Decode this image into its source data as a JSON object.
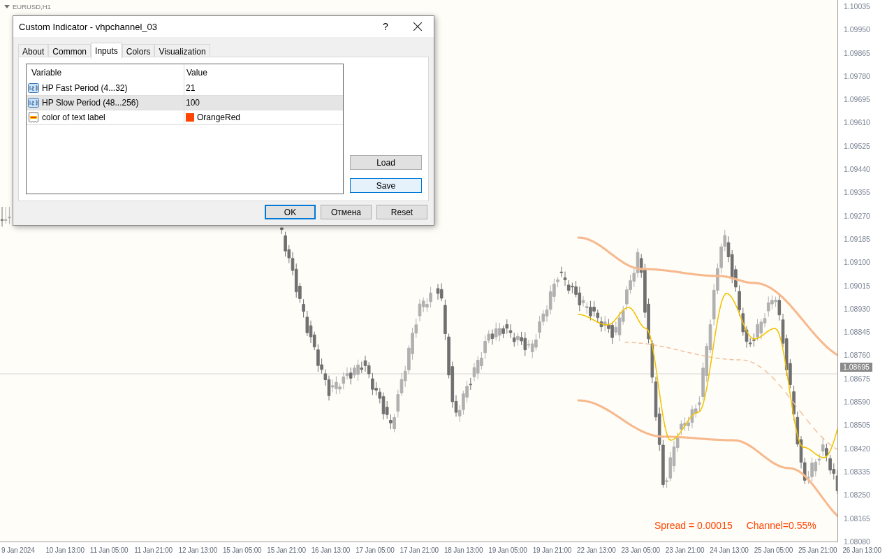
{
  "chart": {
    "symbol": "EURUSD,H1",
    "price_labels": [
      "1.10035",
      "1.09950",
      "1.09865",
      "1.09780",
      "1.09695",
      "1.09610",
      "1.09525",
      "1.09440",
      "1.09355",
      "1.09270",
      "1.09185",
      "1.09100",
      "1.09015",
      "1.08930",
      "1.08845",
      "1.08760",
      "1.08675",
      "1.08590",
      "1.08505",
      "1.08420",
      "1.08335",
      "1.08250",
      "1.08165",
      "1.08080"
    ],
    "current_price": "1.08695",
    "time_labels": [
      "9 Jan 2024",
      "10 Jan 13:00",
      "11 Jan 05:00",
      "11 Jan 21:00",
      "12 Jan 13:00",
      "15 Jan 05:00",
      "15 Jan 21:00",
      "16 Jan 13:00",
      "17 Jan 05:00",
      "17 Jan 21:00",
      "18 Jan 13:00",
      "19 Jan 05:00",
      "19 Jan 21:00",
      "22 Jan 13:00",
      "23 Jan 05:00",
      "23 Jan 21:00",
      "24 Jan 13:00",
      "25 Jan 05:00",
      "25 Jan 21:00",
      "26 Jan 13:00"
    ],
    "info": [
      "Spread = 0.00015",
      "Channel=0.55%"
    ]
  },
  "dialog": {
    "title": "Custom Indicator - vhpchannel_03",
    "help": "?",
    "tabs": [
      {
        "label": "About",
        "selected": false
      },
      {
        "label": "Common",
        "selected": false
      },
      {
        "label": "Inputs",
        "selected": true
      },
      {
        "label": "Colors",
        "selected": false
      },
      {
        "label": "Visualization",
        "selected": false
      }
    ],
    "table": {
      "columns": [
        "Variable",
        "Value"
      ],
      "rows": [
        {
          "kind": "number",
          "variable": "HP Fast Period (4...32)",
          "value": "21",
          "selected": false
        },
        {
          "kind": "number",
          "variable": "HP Slow Period (48...256)",
          "value": "100",
          "selected": true
        },
        {
          "kind": "color",
          "variable": "color of text label",
          "value": "OrangeRed",
          "color": "#ff4500",
          "selected": false
        }
      ]
    },
    "side_buttons": [
      {
        "label": "Load",
        "hovered": false
      },
      {
        "label": "Save",
        "hovered": true
      }
    ],
    "buttons": [
      {
        "label": "OK",
        "default": true
      },
      {
        "label": "Отмена",
        "default": false
      },
      {
        "label": "Reset",
        "default": false
      }
    ]
  }
}
